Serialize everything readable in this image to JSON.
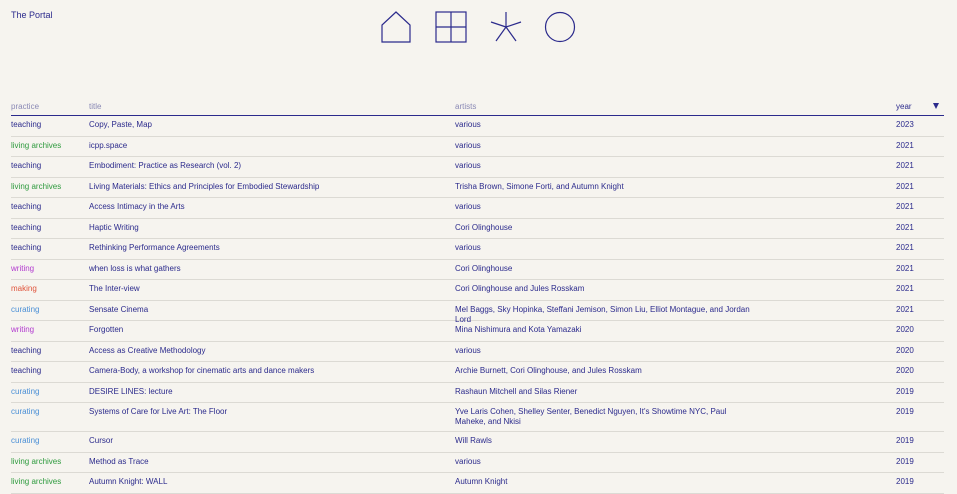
{
  "site": {
    "title": "The Portal"
  },
  "nav": {
    "icons": [
      "home-icon",
      "grid-icon",
      "asterisk-icon",
      "circle-icon"
    ]
  },
  "colors": {
    "ink": "#2b2a8c",
    "teaching": "#2b2a8c",
    "living archives": "#2e9a3e",
    "writing": "#b23ad0",
    "making": "#e0533b",
    "curating": "#4a8fd6"
  },
  "table": {
    "headers": {
      "practice": "practice",
      "title": "title",
      "artists": "artists",
      "year": "year"
    },
    "sort": "year-descending",
    "rows": [
      {
        "practice": "teaching",
        "title": "Copy, Paste, Map",
        "artists": "various",
        "year": "2023"
      },
      {
        "practice": "living archives",
        "title": "icpp.space",
        "artists": "various",
        "year": "2021"
      },
      {
        "practice": "teaching",
        "title": "Embodiment: Practice as Research (vol. 2)",
        "artists": "various",
        "year": "2021"
      },
      {
        "practice": "living archives",
        "title": "Living Materials: Ethics and Principles for Embodied Stewardship",
        "artists": "Trisha Brown, Simone Forti, and Autumn Knight",
        "year": "2021"
      },
      {
        "practice": "teaching",
        "title": "Access Intimacy in the Arts",
        "artists": "various",
        "year": "2021"
      },
      {
        "practice": "teaching",
        "title": "Haptic Writing",
        "artists": "Cori Olinghouse",
        "year": "2021"
      },
      {
        "practice": "teaching",
        "title": "Rethinking Performance Agreements",
        "artists": "various",
        "year": "2021"
      },
      {
        "practice": "writing",
        "title": "when loss is what gathers",
        "artists": "Cori Olinghouse",
        "year": "2021"
      },
      {
        "practice": "making",
        "title": "The Inter-view",
        "artists": "Cori Olinghouse and Jules Rosskam",
        "year": "2021"
      },
      {
        "practice": "curating",
        "title": "Sensate Cinema",
        "artists": "Mel Baggs, Sky Hopinka, Steffani Jemison, Simon Liu, Elliot Montague, and Jordan Lord",
        "year": "2021"
      },
      {
        "practice": "writing",
        "title": "Forgotten",
        "artists": "Mina Nishimura and Kota Yamazaki",
        "year": "2020"
      },
      {
        "practice": "teaching",
        "title": "Access as Creative Methodology",
        "artists": "various",
        "year": "2020"
      },
      {
        "practice": "teaching",
        "title": "Camera-Body, a workshop for cinematic arts and dance makers",
        "artists": "Archie Burnett, Cori Olinghouse, and Jules Rosskam",
        "year": "2020"
      },
      {
        "practice": "curating",
        "title": "DESIRE LINES: lecture",
        "artists": "Rashaun Mitchell and Silas Riener",
        "year": "2019"
      },
      {
        "practice": "curating",
        "title": "Systems of Care for Live Art: The Floor",
        "artists": "Yve Laris Cohen, Shelley Senter, Benedict Nguyen, It's Showtime NYC, Paul Maheke, and Nkisi",
        "year": "2019",
        "tall": true
      },
      {
        "practice": "curating",
        "title": "Cursor",
        "artists": "Will Rawls",
        "year": "2019"
      },
      {
        "practice": "living archives",
        "title": "Method as Trace",
        "artists": "various",
        "year": "2019"
      },
      {
        "practice": "living archives",
        "title": "Autumn Knight: WALL",
        "artists": "Autumn Knight",
        "year": "2019"
      }
    ]
  }
}
